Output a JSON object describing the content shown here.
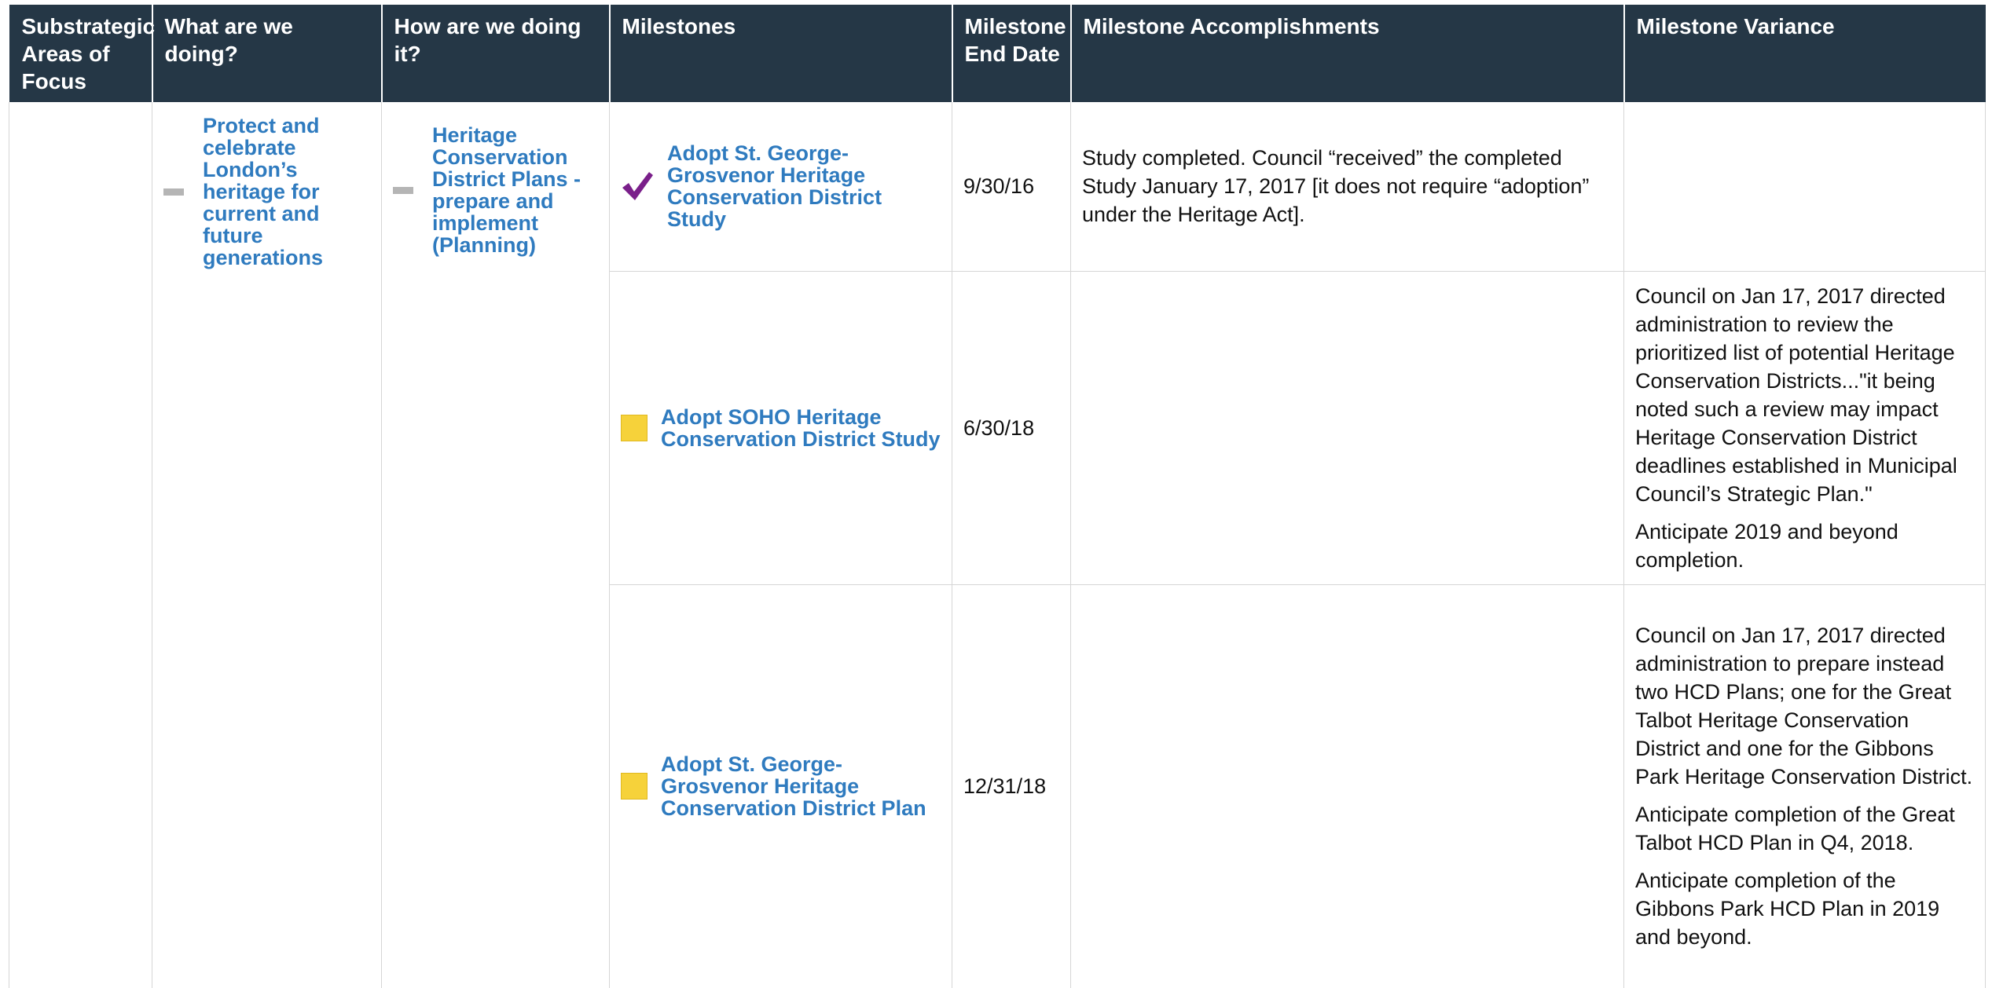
{
  "headers": [
    "Substrategic Areas of Focus",
    "What are we doing?",
    "How are we doing it?",
    "Milestones",
    "Milestone End Date",
    "Milestone Accomplishments",
    "Milestone Variance"
  ],
  "what": "Protect and celebrate London’s heritage for current and future generations",
  "how": "Heritage Conservation District Plans - prepare and implement (Planning)",
  "status_colors": {
    "complete": "#7a1f8a",
    "caution": "#f6d23a"
  },
  "rows": [
    {
      "status_icon": "check-icon",
      "milestone": "Adopt St. George-Grosvenor Heritage Conservation District Study",
      "end_date": "9/30/16",
      "accomplishments": "Study completed. Council “received” the completed Study January 17, 2017 [it does not require “adoption” under the Heritage Act].",
      "variance": []
    },
    {
      "status_icon": "yellow-square-icon",
      "milestone": "Adopt SOHO Heritage Conservation District Study",
      "end_date": "6/30/18",
      "accomplishments": "",
      "variance": [
        "Council on Jan 17, 2017 directed administration to review the prioritized list of potential Heritage Conservation Districts...\"it being noted such a review may impact Heritage Conservation District deadlines established in Municipal Council’s Strategic Plan.\"",
        "Anticipate 2019 and beyond completion."
      ]
    },
    {
      "status_icon": "yellow-square-icon",
      "milestone": "Adopt St. George-Grosvenor Heritage Conservation District Plan",
      "end_date": "12/31/18",
      "accomplishments": "",
      "variance": [
        "Council on Jan 17, 2017 directed administration to prepare instead two HCD Plans; one for the Great Talbot Heritage Conservation District and one for the Gibbons Park Heritage Conservation District.",
        "Anticipate completion of the Great Talbot HCD Plan in Q4, 2018.",
        "Anticipate completion of the Gibbons Park HCD Plan in 2019 and beyond."
      ]
    }
  ]
}
